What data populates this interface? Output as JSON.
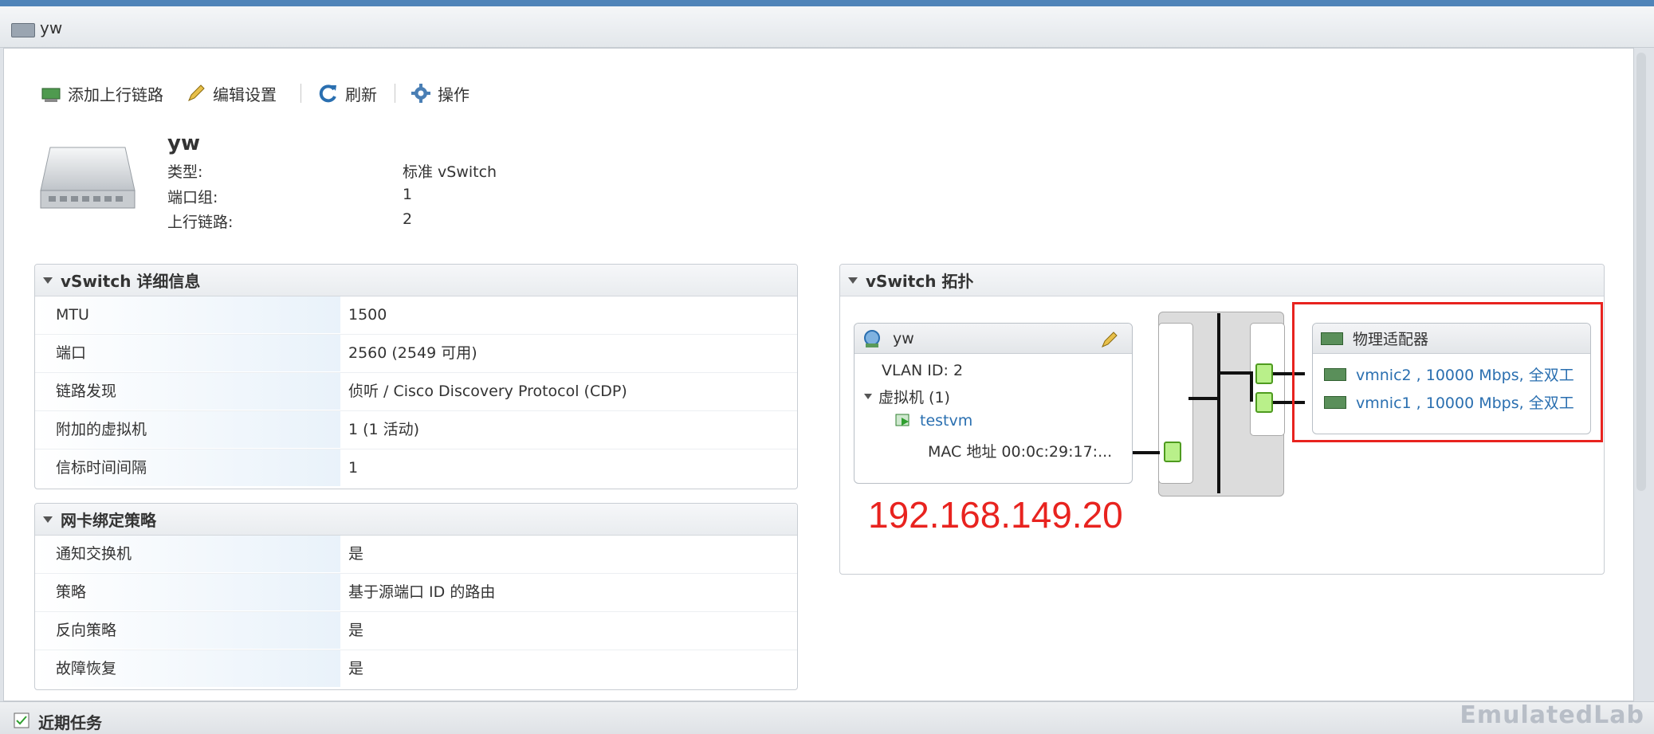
{
  "window": {
    "title": "yw"
  },
  "toolbar": {
    "add_uplink": "添加上行链路",
    "edit_settings": "编辑设置",
    "refresh": "刷新",
    "actions": "操作"
  },
  "summary": {
    "name": "yw",
    "rows": [
      {
        "label": "类型:",
        "value": "标准 vSwitch"
      },
      {
        "label": "端口组:",
        "value": "1"
      },
      {
        "label": "上行链路:",
        "value": "2"
      }
    ]
  },
  "details": {
    "title": "vSwitch 详细信息",
    "rows": [
      {
        "key": "MTU",
        "value": "1500"
      },
      {
        "key": "端口",
        "value": "2560 (2549 可用)"
      },
      {
        "key": "链路发现",
        "value": "侦听 / Cisco Discovery Protocol (CDP)"
      },
      {
        "key": "附加的虚拟机",
        "value": "1 (1 活动)"
      },
      {
        "key": "信标时间间隔",
        "value": "1"
      }
    ]
  },
  "teaming": {
    "title": "网卡绑定策略",
    "rows": [
      {
        "key": "通知交换机",
        "value": "是"
      },
      {
        "key": "策略",
        "value": "基于源端口 ID 的路由"
      },
      {
        "key": "反向策略",
        "value": "是"
      },
      {
        "key": "故障恢复",
        "value": "是"
      }
    ]
  },
  "topology": {
    "title": "vSwitch 拓扑",
    "portgroup": {
      "name": "yw",
      "vlan": "VLAN ID: 2",
      "vms_label": "虚拟机 (1)",
      "vm_name": "testvm",
      "mac": "MAC 地址 00:0c:29:17:..."
    },
    "adapters": {
      "title": "物理适配器",
      "items": [
        "vmnic2 , 10000 Mbps, 全双工",
        "vmnic1 , 10000 Mbps, 全双工"
      ]
    },
    "annotation": "192.168.149.20"
  },
  "footer": {
    "recent_tasks": "近期任务"
  },
  "watermark": "EmulatedLab",
  "colors": {
    "highlight_red": "#e8231f",
    "annotation_red": "#e8231f",
    "link_blue": "#2a6fb0",
    "port_green": "#b9f08a"
  }
}
